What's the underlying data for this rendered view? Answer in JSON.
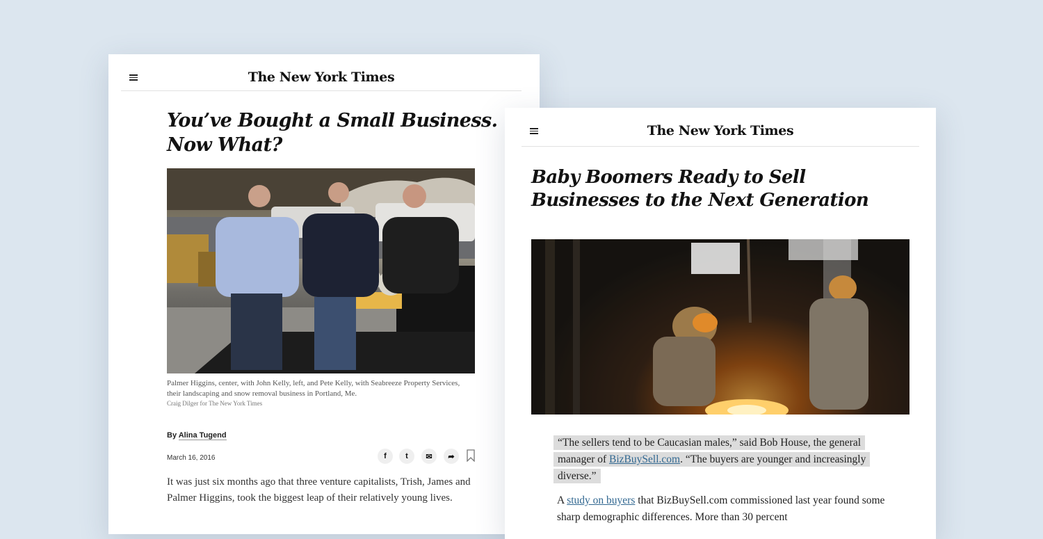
{
  "article1": {
    "masthead": {
      "logo": "The New York Times",
      "menu_icon": "hamburger-menu-icon"
    },
    "headline": {
      "line1": "You’ve Bought a Small Business.",
      "line2": "Now What?"
    },
    "photo": {
      "description_icon": "photo-three-men-with-snowplows"
    },
    "caption": "Palmer Higgins, center, with John Kelly, left, and Pete Kelly, with Seabreeze Property Services, their landscaping and snow removal business in Portland, Me.",
    "credit": "Craig Dilger for The New York Times",
    "byline": {
      "prefix": "By",
      "author": "Alina Tugend"
    },
    "date": "March 16, 2016",
    "share": {
      "facebook": "f",
      "twitter": "t",
      "email": "✉",
      "share": "➦"
    },
    "body": "It was just six months ago that three venture capitalists, Trish, James and Palmer Higgins, took the biggest leap of their relatively young lives."
  },
  "article2": {
    "masthead": {
      "logo": "The New York Times",
      "menu_icon": "hamburger-menu-icon"
    },
    "headline": {
      "line1": "Baby Boomers Ready to Sell",
      "line2": "Businesses to the Next Generation"
    },
    "quote": {
      "part1": "“The sellers tend to be Caucasian males,” said Bob House, the general manager of ",
      "link": "BizBuySell.com",
      "part2": ". “The buyers are younger and increasingly diverse.”"
    },
    "body": {
      "part1": "A ",
      "link": "study on buyers",
      "part2": " that BizBuySell.com commissioned last year found some sharp demographic differences. More than 30 percent"
    }
  },
  "colors": {
    "background": "#dce6ef",
    "link": "#326891",
    "highlight": "#dcdcdc"
  }
}
